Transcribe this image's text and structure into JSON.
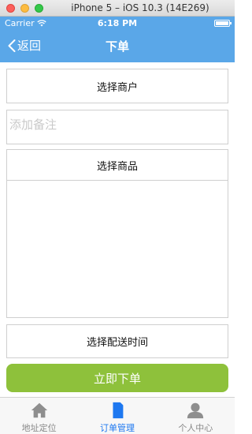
{
  "window": {
    "title": "iPhone 5 – iOS 10.3 (14E269)"
  },
  "statusbar": {
    "carrier": "Carrier",
    "time": "6:18 PM"
  },
  "navbar": {
    "back_label": "返回",
    "title": "下单"
  },
  "form": {
    "merchant_label": "选择商户",
    "note_placeholder": "添加备注",
    "goods_label": "选择商品",
    "delivery_label": "选择配送时间",
    "submit_label": "立即下单"
  },
  "tabbar": {
    "tabs": [
      {
        "label": "地址定位",
        "icon": "home-icon",
        "active": false
      },
      {
        "label": "订单管理",
        "icon": "document-icon",
        "active": true
      },
      {
        "label": "个人中心",
        "icon": "person-icon",
        "active": false
      }
    ]
  },
  "colors": {
    "header_blue": "#5aa7e8",
    "submit_green": "#8ec13b",
    "tab_active": "#1e78f0",
    "tab_inactive": "#8e8e8e"
  }
}
